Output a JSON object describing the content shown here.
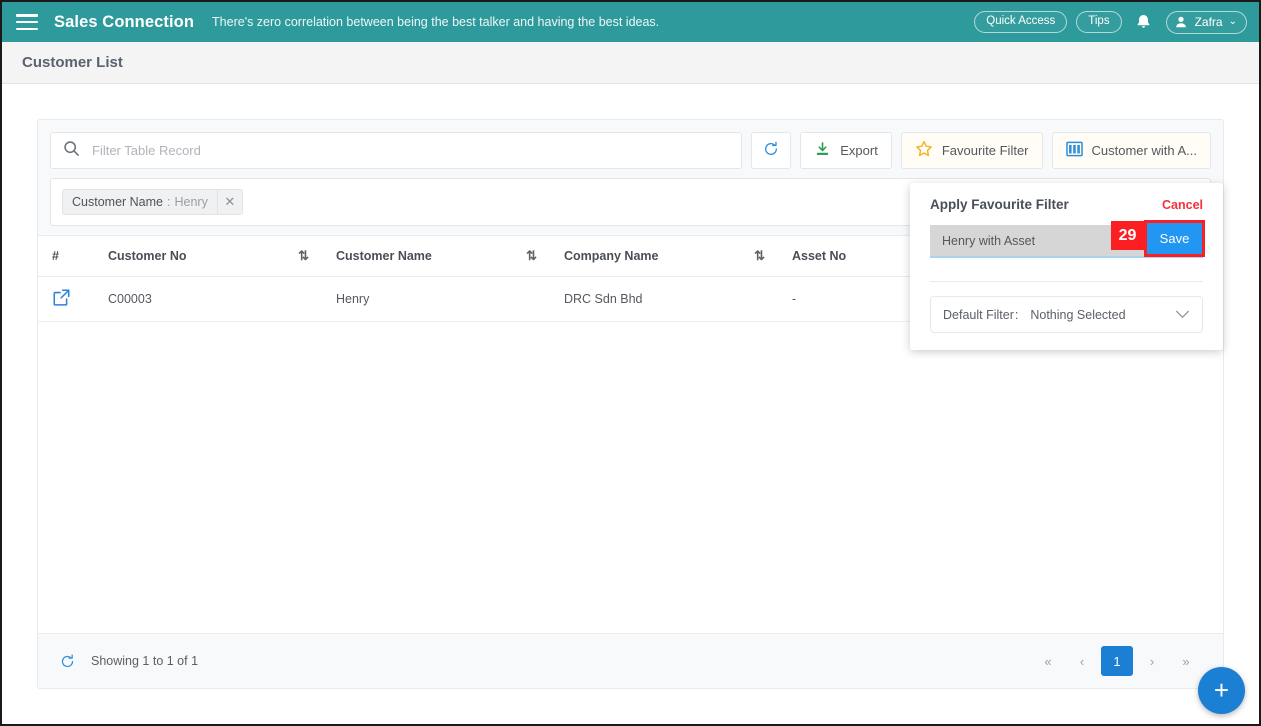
{
  "topbar": {
    "menu_icon": "hamburger-menu-icon",
    "brand": "Sales Connection",
    "tagline": "There's zero correlation between being the best talker and having the best ideas.",
    "quick_access_label": "Quick Access",
    "tips_label": "Tips",
    "notification_icon": "bell-icon",
    "user_name": "Zafra",
    "user_caret": "⌄",
    "background_color": "#2e9a9b"
  },
  "page": {
    "title": "Customer List"
  },
  "search": {
    "icon": "search-icon",
    "placeholder": "Filter Table Record",
    "value": ""
  },
  "toolbar": {
    "refresh_icon": "refresh-icon",
    "export_label": "Export",
    "export_icon": "download-icon",
    "favourite_filter_label": "Favourite Filter",
    "favourite_filter_icon": "star-icon",
    "columns_label": "Customer with A...",
    "columns_icon": "columns-icon"
  },
  "active_filters": [
    {
      "key": "Customer Name",
      "separator": ":",
      "value": "Henry",
      "remove_icon": "close-icon"
    }
  ],
  "table": {
    "columns": [
      {
        "label": "#",
        "sortable": false
      },
      {
        "label": "Customer No",
        "sortable": true
      },
      {
        "label": "Customer Name",
        "sortable": true
      },
      {
        "label": "Company Name",
        "sortable": true
      },
      {
        "label": "Asset No",
        "sortable": false
      }
    ],
    "sort_icon": "sort-updown-icon",
    "row_action_icon": "open-in-new-icon",
    "rows": [
      {
        "customer_no": "C00003",
        "customer_name": "Henry",
        "company_name": "DRC Sdn Bhd",
        "asset_no": "-"
      }
    ]
  },
  "footer": {
    "refresh_icon": "refresh-icon",
    "showing_text": "Showing 1 to 1 of 1",
    "pagination": {
      "first": "«",
      "prev": "‹",
      "current_page": "1",
      "next": "›",
      "last": "»"
    }
  },
  "popover": {
    "title": "Apply Favourite Filter",
    "cancel_label": "Cancel",
    "filter_name_value": "Henry with Asset",
    "filter_name_placeholder": "",
    "annotation_badge": "29",
    "save_label": "Save",
    "default_filter_label": "Default Filter",
    "default_filter_colon": ":",
    "default_filter_value": "Nothing Selected",
    "dropdown_caret_icon": "chevron-down-icon",
    "highlight_color": "#fb1f23",
    "save_button_color": "#2196f3"
  },
  "fab": {
    "icon": "plus-icon",
    "color": "#1b7fd4"
  }
}
